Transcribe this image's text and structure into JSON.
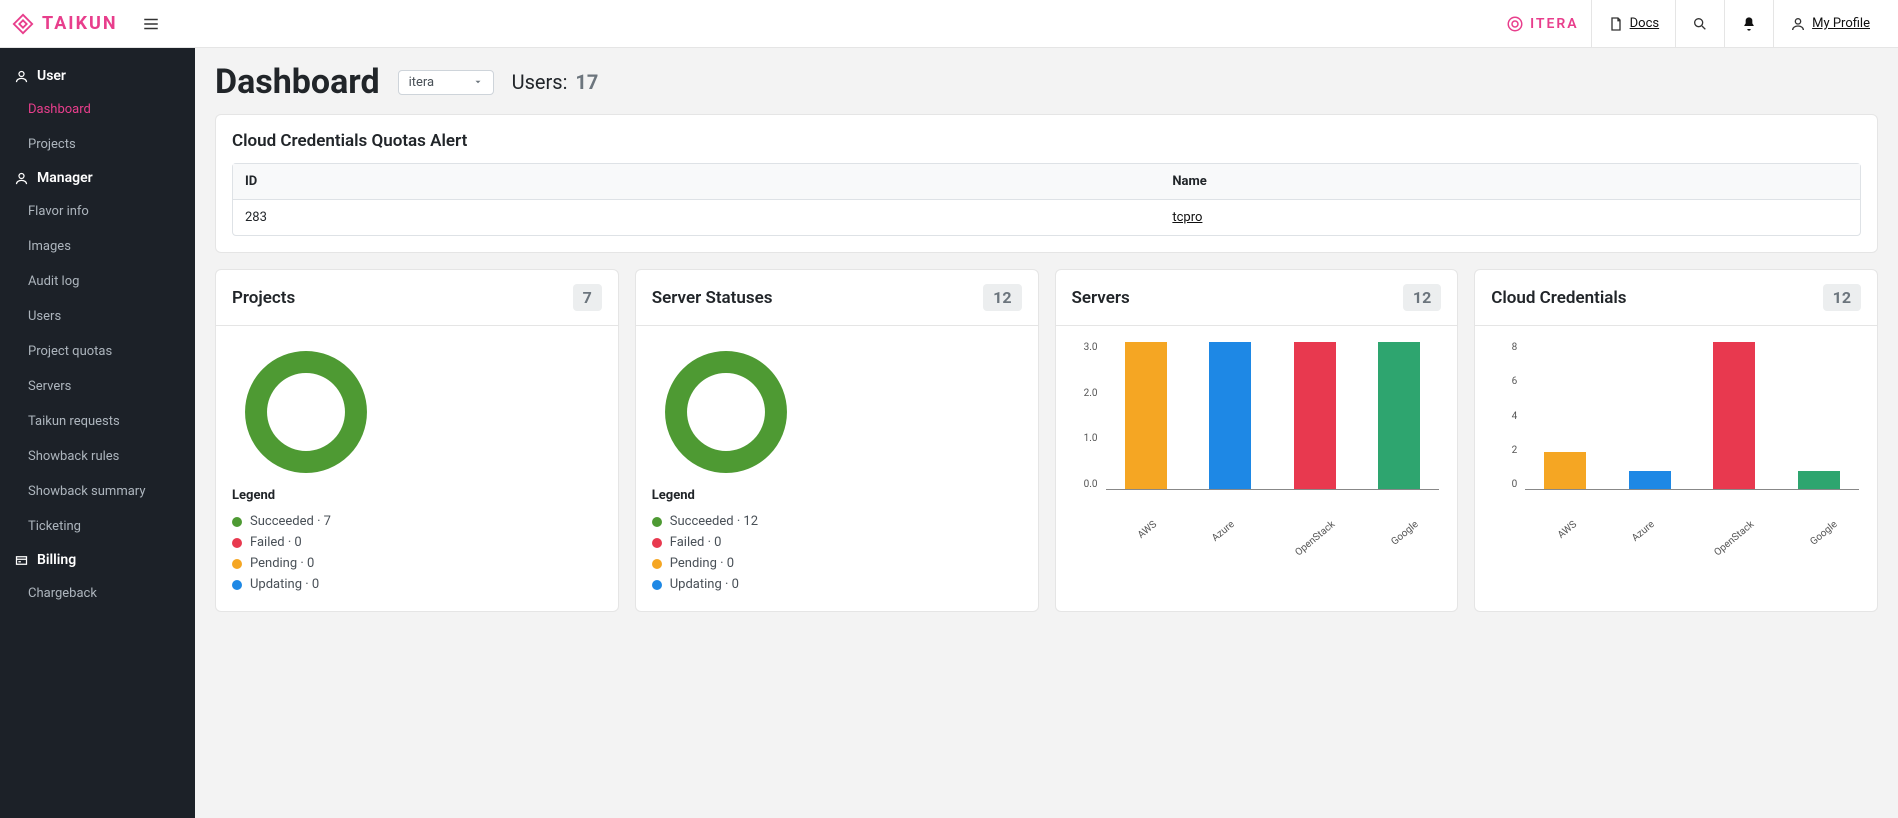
{
  "brand": {
    "name": "TAIKUN",
    "org": "ITERA"
  },
  "topbar": {
    "docs": "Docs",
    "profile": "My Profile"
  },
  "sidebar": {
    "user_section": "User",
    "manager_section": "Manager",
    "billing_section": "Billing",
    "user_items": [
      "Dashboard",
      "Projects"
    ],
    "manager_items": [
      "Flavor info",
      "Images",
      "Audit log",
      "Users",
      "Project quotas",
      "Servers",
      "Taikun requests",
      "Showback rules",
      "Showback summary",
      "Ticketing"
    ],
    "billing_items": [
      "Chargeback"
    ]
  },
  "header": {
    "title": "Dashboard",
    "org_selected": "itera",
    "users_label": "Users:",
    "users_count": "17"
  },
  "alert_panel": {
    "title": "Cloud Credentials Quotas Alert",
    "col_id": "ID",
    "col_name": "Name",
    "row_id": "283",
    "row_name": "tcpro"
  },
  "legend_title": "Legend",
  "status_labels": {
    "succeeded": "Succeeded",
    "failed": "Failed",
    "pending": "Pending",
    "updating": "Updating"
  },
  "cards": {
    "projects": {
      "title": "Projects",
      "count": "7",
      "succeeded": 7,
      "failed": 0,
      "pending": 0,
      "updating": 0,
      "leg_s": "Succeeded · 7",
      "leg_f": "Failed · 0",
      "leg_p": "Pending · 0",
      "leg_u": "Updating · 0"
    },
    "server_statuses": {
      "title": "Server Statuses",
      "count": "12",
      "succeeded": 12,
      "failed": 0,
      "pending": 0,
      "updating": 0,
      "leg_s": "Succeeded · 12",
      "leg_f": "Failed · 0",
      "leg_p": "Pending · 0",
      "leg_u": "Updating · 0"
    },
    "servers": {
      "title": "Servers",
      "count": "12"
    },
    "cloud_credentials": {
      "title": "Cloud Credentials",
      "count": "12"
    }
  },
  "chart_data": [
    {
      "id": "projects_donut",
      "type": "pie",
      "title": "Projects",
      "series": [
        {
          "name": "Succeeded",
          "value": 7,
          "color": "#4e9a33"
        },
        {
          "name": "Failed",
          "value": 0,
          "color": "#e8394f"
        },
        {
          "name": "Pending",
          "value": 0,
          "color": "#f5a623"
        },
        {
          "name": "Updating",
          "value": 0,
          "color": "#1e88e5"
        }
      ]
    },
    {
      "id": "server_statuses_donut",
      "type": "pie",
      "title": "Server Statuses",
      "series": [
        {
          "name": "Succeeded",
          "value": 12,
          "color": "#4e9a33"
        },
        {
          "name": "Failed",
          "value": 0,
          "color": "#e8394f"
        },
        {
          "name": "Pending",
          "value": 0,
          "color": "#f5a623"
        },
        {
          "name": "Updating",
          "value": 0,
          "color": "#1e88e5"
        }
      ]
    },
    {
      "id": "servers_bar",
      "type": "bar",
      "title": "Servers",
      "categories": [
        "AWS",
        "Azure",
        "OpenStack",
        "Google"
      ],
      "values": [
        3,
        3,
        3,
        3
      ],
      "ylim": [
        0,
        3
      ],
      "yticks": [
        "3.0",
        "2.0",
        "1.0",
        "0.0"
      ],
      "colors": [
        "#f5a623",
        "#1e88e5",
        "#e8394f",
        "#2ea56f"
      ]
    },
    {
      "id": "cloud_credentials_bar",
      "type": "bar",
      "title": "Cloud Credentials",
      "categories": [
        "AWS",
        "Azure",
        "OpenStack",
        "Google"
      ],
      "values": [
        2,
        1,
        8,
        1
      ],
      "ylim": [
        0,
        8
      ],
      "yticks": [
        "8",
        "6",
        "4",
        "2",
        "0"
      ],
      "colors": [
        "#f5a623",
        "#1e88e5",
        "#e8394f",
        "#2ea56f"
      ]
    }
  ]
}
